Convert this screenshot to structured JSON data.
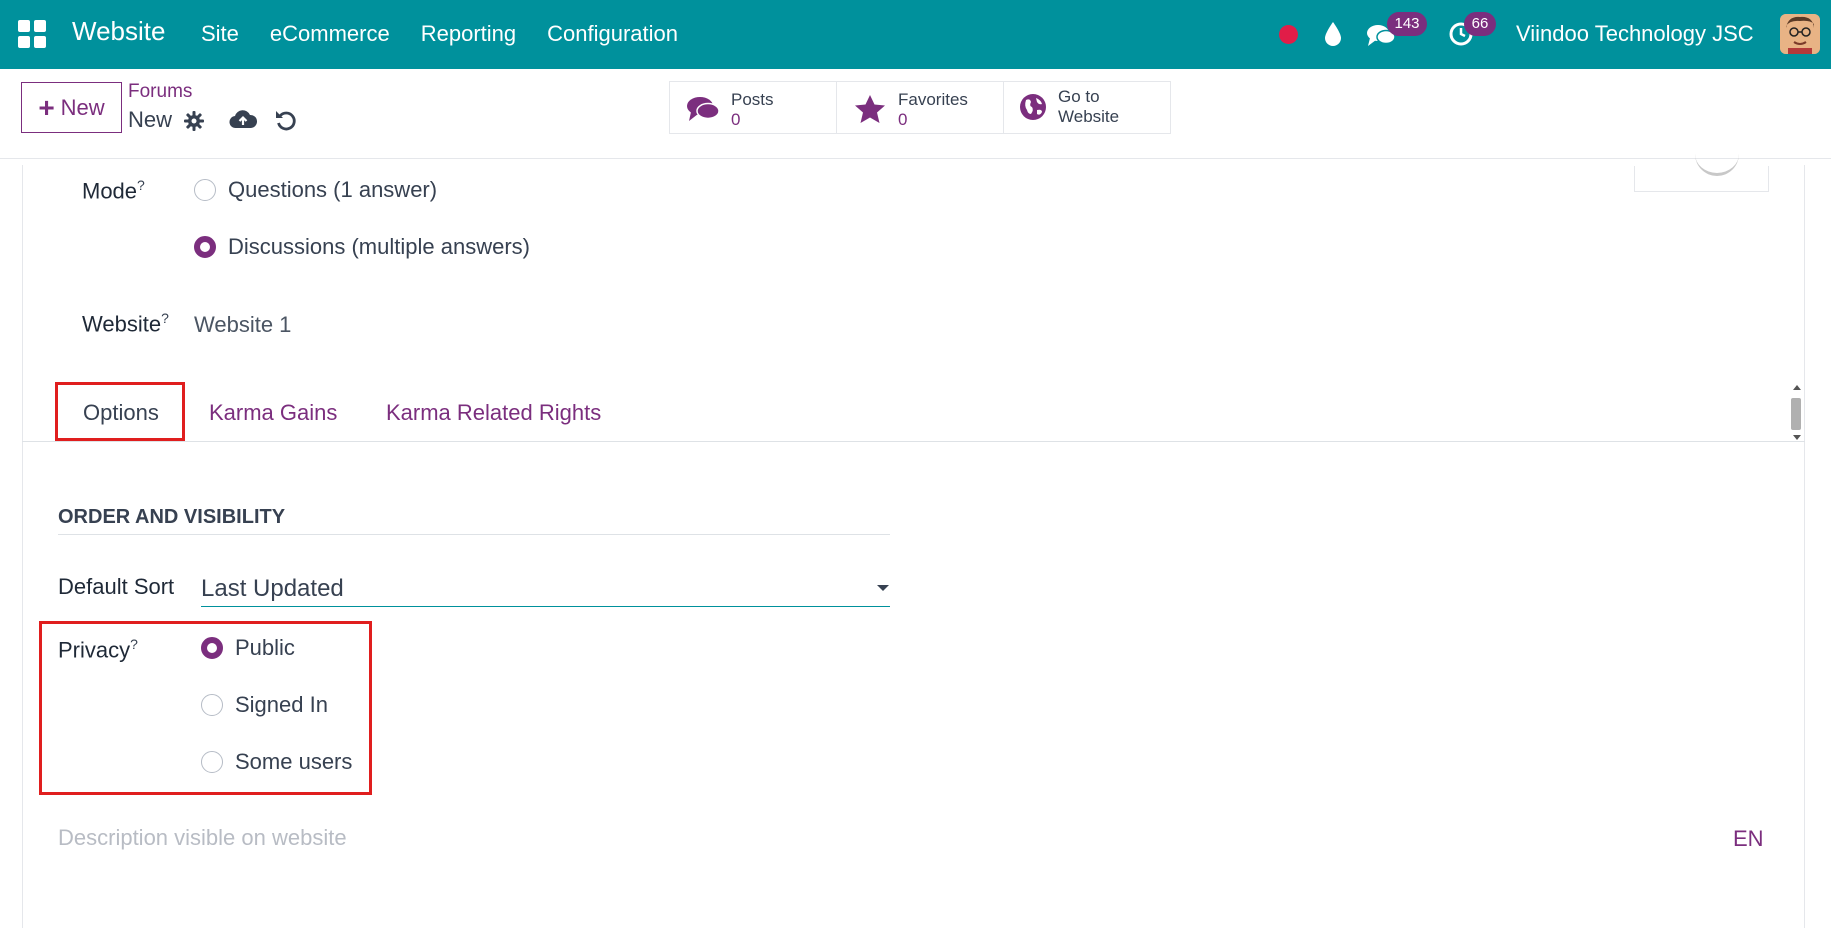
{
  "navbar": {
    "brand": "Website",
    "menu": [
      "Site",
      "eCommerce",
      "Reporting",
      "Configuration"
    ],
    "messages_count": "143",
    "activities_count": "66",
    "company": "Viindoo Technology JSC",
    "bg_color": "#00919c"
  },
  "control_panel": {
    "new_label": "New",
    "breadcrumb_parent": "Forums",
    "breadcrumb_current": "New",
    "stats": {
      "posts_label": "Posts",
      "posts_value": "0",
      "favorites_label": "Favorites",
      "favorites_value": "0",
      "goto_line1": "Go to",
      "goto_line2": "Website"
    }
  },
  "form": {
    "mode_label": "Mode",
    "mode_options": [
      "Questions (1 answer)",
      "Discussions (multiple answers)"
    ],
    "mode_selected": "Discussions (multiple answers)",
    "website_label": "Website",
    "website_value": "Website 1",
    "help_mark": "?"
  },
  "tabs": [
    "Options",
    "Karma Gains",
    "Karma Related Rights"
  ],
  "active_tab": "Options",
  "options": {
    "section_title": "ORDER AND VISIBILITY",
    "default_sort_label": "Default Sort",
    "default_sort_value": "Last Updated",
    "privacy_label": "Privacy",
    "privacy_options": [
      "Public",
      "Signed In",
      "Some users"
    ],
    "privacy_selected": "Public",
    "description_placeholder": "Description visible on website",
    "lang": "EN"
  },
  "colors": {
    "accent": "#7b2e7e",
    "highlight": "#e01e1e"
  }
}
